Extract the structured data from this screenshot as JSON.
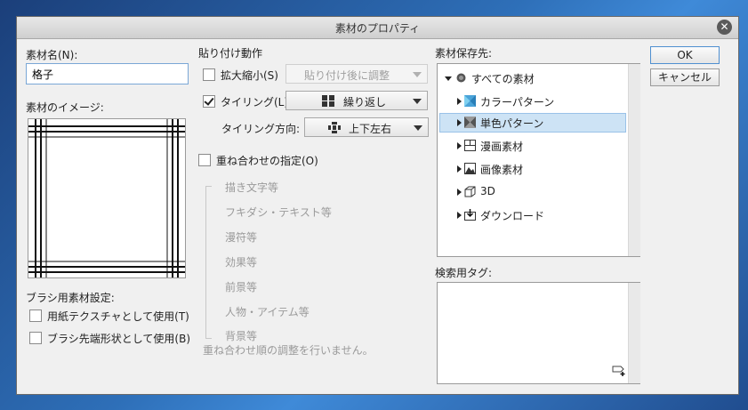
{
  "dialog": {
    "title": "素材のプロパティ"
  },
  "left": {
    "name_label": "素材名(N):",
    "name_value": "格子",
    "image_label": "素材のイメージ:",
    "brush_label": "ブラシ用素材設定:",
    "paper_texture": {
      "label": "用紙テクスチャとして使用(T)",
      "checked": false
    },
    "brush_tip": {
      "label": "ブラシ先端形状として使用(B)",
      "checked": false
    }
  },
  "paste": {
    "section_label": "貼り付け動作",
    "scale": {
      "label": "拡大縮小(S)",
      "checked": false,
      "dropdown": "貼り付け後に調整"
    },
    "tiling": {
      "label": "タイリング(L)",
      "checked": true,
      "dropdown": "繰り返し"
    },
    "direction_label": "タイリング方向:",
    "direction_dropdown": "上下左右",
    "overlay": {
      "label": "重ね合わせの指定(O)",
      "checked": false
    },
    "order_items": [
      "描き文字等",
      "フキダシ・テキスト等",
      "漫符等",
      "効果等",
      "前景等",
      "人物・アイテム等",
      "背景等"
    ],
    "order_note": "重ね合わせ順の調整を行いません。"
  },
  "storage": {
    "label": "素材保存先:",
    "root": "すべての素材",
    "items": [
      {
        "label": "カラーパターン",
        "icon": "color-pattern-icon"
      },
      {
        "label": "単色パターン",
        "icon": "mono-pattern-icon",
        "selected": true
      },
      {
        "label": "漫画素材",
        "icon": "manga-icon"
      },
      {
        "label": "画像素材",
        "icon": "image-icon"
      },
      {
        "label": "3D",
        "icon": "cube-icon"
      },
      {
        "label": "ダウンロード",
        "icon": "download-icon"
      }
    ]
  },
  "tags": {
    "label": "検索用タグ:"
  },
  "buttons": {
    "ok": "OK",
    "cancel": "キャンセル"
  },
  "colors": {
    "selection": "#cde3f5",
    "accent": "#4f8fd0"
  }
}
